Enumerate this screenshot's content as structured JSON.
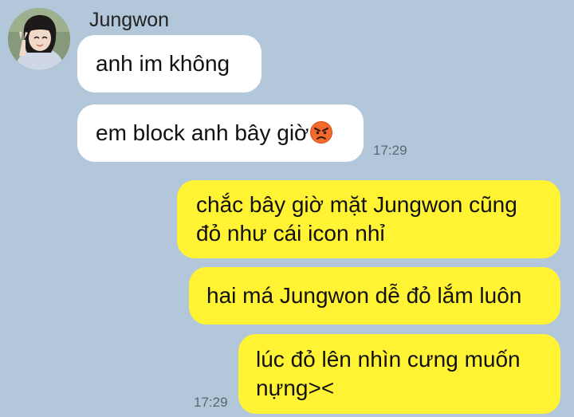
{
  "contact": {
    "name": "Jungwon",
    "avatar_icon": "profile-photo"
  },
  "messages": [
    {
      "direction": "incoming",
      "text": "anh im không"
    },
    {
      "direction": "incoming",
      "text": "em block anh bây giờ",
      "emoji": "angry-face"
    },
    {
      "direction": "outgoing",
      "text": "chắc bây giờ mặt Jungwon cũng đỏ như cái icon nhỉ"
    },
    {
      "direction": "outgoing",
      "text": "hai má Jungwon dễ đỏ lắm luôn"
    },
    {
      "direction": "outgoing",
      "text": "lúc đỏ lên nhìn cưng muốn nựng><"
    }
  ],
  "timestamps": {
    "incoming_group": "17:29",
    "outgoing_group": "17:29"
  },
  "colors": {
    "background": "#b2c7da",
    "incoming_bubble": "#ffffff",
    "outgoing_bubble": "#fff334",
    "timestamp": "#5b6671"
  }
}
